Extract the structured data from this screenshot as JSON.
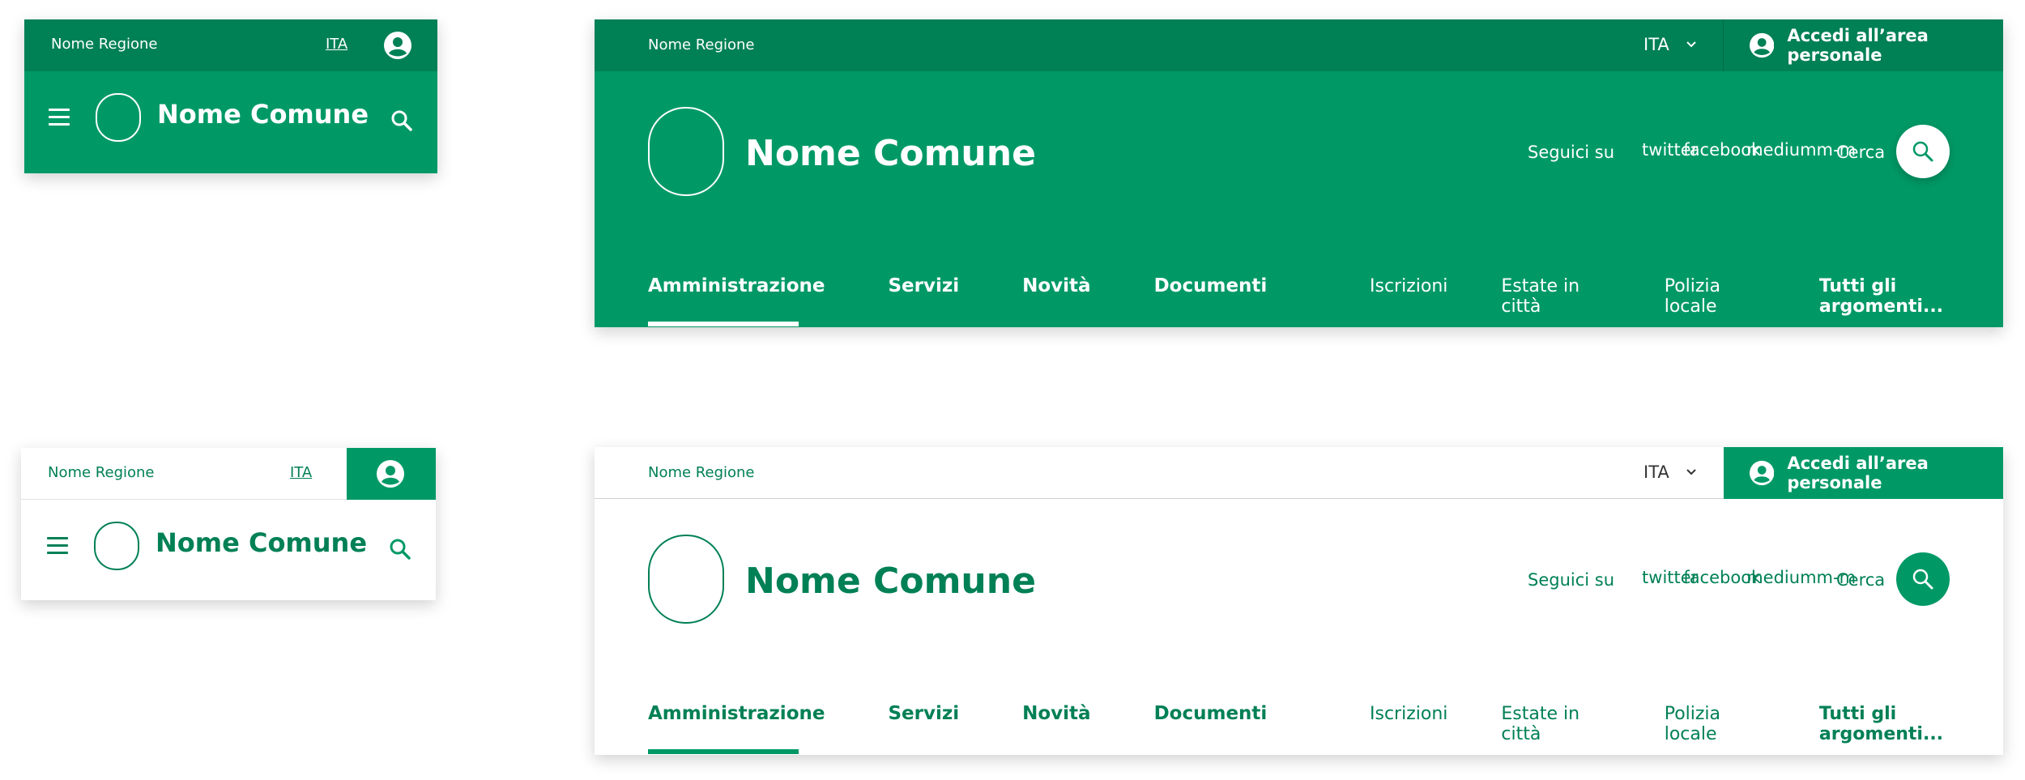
{
  "colors": {
    "primary": "#009966",
    "primary_dark": "#008055",
    "white": "#ffffff"
  },
  "mobile_green": {
    "region": "Nome Regione",
    "lang": "ITA",
    "title": "Nome Comune",
    "icons": [
      "hamburger-icon",
      "user-icon",
      "search-icon"
    ]
  },
  "mobile_white": {
    "region": "Nome Regione",
    "lang": "ITA",
    "title": "Nome Comune",
    "icons": [
      "hamburger-icon",
      "user-icon",
      "search-icon"
    ]
  },
  "desktop_green": {
    "region": "Nome Regione",
    "lang": "ITA",
    "account": "Accedi all’area personale",
    "title": "Nome Comune",
    "follow": "Seguici su",
    "social": [
      "twitter",
      "facebook",
      "medium",
      "m-m"
    ],
    "search": "Cerca",
    "nav": [
      "Amministrazione",
      "Servizi",
      "Novità",
      "Documenti"
    ],
    "topics": [
      "Iscrizioni",
      "Estate in città",
      "Polizia locale",
      "Tutti gli argomenti..."
    ]
  },
  "desktop_white": {
    "region": "Nome Regione",
    "lang": "ITA",
    "account": "Accedi all’area personale",
    "title": "Nome Comune",
    "follow": "Seguici su",
    "social": [
      "twitter",
      "facebook",
      "medium",
      "m-m"
    ],
    "search": "Cerca",
    "nav": [
      "Amministrazione",
      "Servizi",
      "Novità",
      "Documenti"
    ],
    "topics": [
      "Iscrizioni",
      "Estate in città",
      "Polizia locale",
      "Tutti gli argomenti..."
    ]
  }
}
